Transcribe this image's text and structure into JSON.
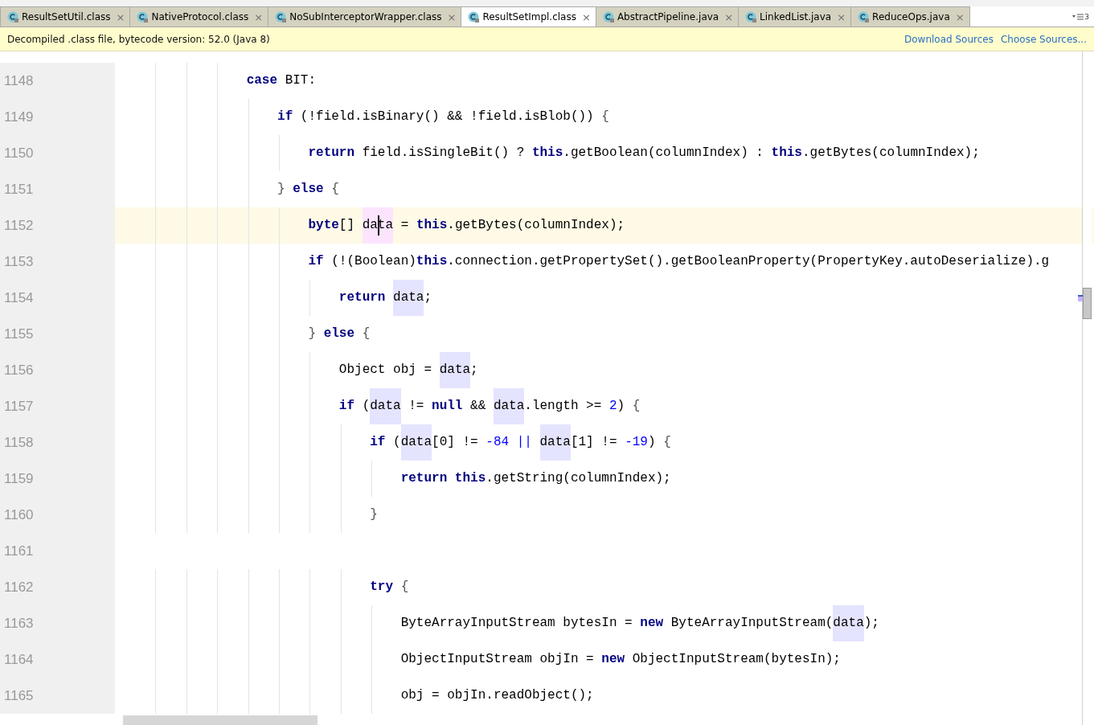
{
  "tabs": [
    {
      "label": "ResultSetUtil.class",
      "selected": false,
      "close": "×"
    },
    {
      "label": "NativeProtocol.class",
      "selected": false,
      "close": "×"
    },
    {
      "label": "NoSubInterceptorWrapper.class",
      "selected": false,
      "close": "×"
    },
    {
      "label": "ResultSetImpl.class",
      "selected": true,
      "close": "×"
    },
    {
      "label": "AbstractPipeline.java",
      "selected": false,
      "close": "×"
    },
    {
      "label": "LinkedList.java",
      "selected": false,
      "close": "×"
    },
    {
      "label": "ReduceOps.java",
      "selected": false,
      "close": "×"
    }
  ],
  "tab_overflow": {
    "count": "3"
  },
  "banner": {
    "message": "Decompiled .class file, bytecode version: 52.0 (Java 8)",
    "links": [
      "Download Sources",
      "Choose Sources..."
    ]
  },
  "lines": [
    {
      "number": "1148",
      "current": false,
      "tokens": [
        {
          "kind": "kw",
          "text": "                case"
        },
        {
          "kind": "plain",
          "text": " BIT:"
        }
      ]
    },
    {
      "number": "1149",
      "current": false,
      "tokens": [
        {
          "kind": "kw",
          "text": "                    if"
        },
        {
          "kind": "plain",
          "text": " (!field.isBinary() && !field.isBlob()) "
        },
        {
          "kind": "brace",
          "text": "{"
        }
      ]
    },
    {
      "number": "1150",
      "current": false,
      "tokens": [
        {
          "kind": "kw",
          "text": "                        return"
        },
        {
          "kind": "plain",
          "text": " field.isSingleBit() ? "
        },
        {
          "kind": "kw",
          "text": "this"
        },
        {
          "kind": "plain",
          "text": ".getBoolean(columnIndex) : "
        },
        {
          "kind": "kw",
          "text": "this"
        },
        {
          "kind": "plain",
          "text": ".getBytes(columnIndex);"
        }
      ]
    },
    {
      "number": "1151",
      "current": false,
      "tokens": [
        {
          "kind": "brace",
          "text": "                    }"
        },
        {
          "kind": "kw",
          "text": " else"
        },
        {
          "kind": "brace",
          "text": " {"
        }
      ]
    },
    {
      "number": "1152",
      "current": true,
      "tokens": [
        {
          "kind": "kw",
          "text": "                        byte"
        },
        {
          "kind": "plain",
          "text": "[] "
        },
        {
          "kind": "write",
          "text": "data",
          "caret": true
        },
        {
          "kind": "plain",
          "text": " = "
        },
        {
          "kind": "kw",
          "text": "this"
        },
        {
          "kind": "plain",
          "text": ".getBytes(columnIndex);"
        }
      ]
    },
    {
      "number": "1153",
      "current": false,
      "tokens": [
        {
          "kind": "kw",
          "text": "                        if"
        },
        {
          "kind": "plain",
          "text": " (!(Boolean)"
        },
        {
          "kind": "kw",
          "text": "this"
        },
        {
          "kind": "plain",
          "text": ".connection.getPropertySet().getBooleanProperty(PropertyKey.autoDeserialize).g"
        }
      ]
    },
    {
      "number": "1154",
      "current": false,
      "tokens": [
        {
          "kind": "kw",
          "text": "                            return "
        },
        {
          "kind": "ref",
          "text": "data"
        },
        {
          "kind": "plain",
          "text": ";"
        }
      ]
    },
    {
      "number": "1155",
      "current": false,
      "tokens": [
        {
          "kind": "brace",
          "text": "                        }"
        },
        {
          "kind": "kw",
          "text": " else"
        },
        {
          "kind": "brace",
          "text": " {"
        }
      ]
    },
    {
      "number": "1156",
      "current": false,
      "tokens": [
        {
          "kind": "plain",
          "text": "                            Object obj = "
        },
        {
          "kind": "ref",
          "text": "data"
        },
        {
          "kind": "plain",
          "text": ";"
        }
      ]
    },
    {
      "number": "1157",
      "current": false,
      "tokens": [
        {
          "kind": "kw",
          "text": "                            if"
        },
        {
          "kind": "plain",
          "text": " ("
        },
        {
          "kind": "ref",
          "text": "data"
        },
        {
          "kind": "plain",
          "text": " != "
        },
        {
          "kind": "kw",
          "text": "null"
        },
        {
          "kind": "plain",
          "text": " && "
        },
        {
          "kind": "ref",
          "text": "data"
        },
        {
          "kind": "plain",
          "text": ".length >= "
        },
        {
          "kind": "num",
          "text": "2"
        },
        {
          "kind": "plain",
          "text": ") "
        },
        {
          "kind": "brace",
          "text": "{"
        }
      ]
    },
    {
      "number": "1158",
      "current": false,
      "tokens": [
        {
          "kind": "kw",
          "text": "                                if"
        },
        {
          "kind": "plain",
          "text": " ("
        },
        {
          "kind": "ref",
          "text": "data"
        },
        {
          "kind": "plain",
          "text": "[0] != "
        },
        {
          "kind": "num",
          "text": "-84 || "
        },
        {
          "kind": "ref",
          "text": "data"
        },
        {
          "kind": "plain",
          "text": "[1] != "
        },
        {
          "kind": "num",
          "text": "-19"
        },
        {
          "kind": "plain",
          "text": ") "
        },
        {
          "kind": "brace",
          "text": "{"
        }
      ]
    },
    {
      "number": "1159",
      "current": false,
      "tokens": [
        {
          "kind": "kw",
          "text": "                                    return this"
        },
        {
          "kind": "plain",
          "text": ".getString(columnIndex);"
        }
      ]
    },
    {
      "number": "1160",
      "current": false,
      "tokens": [
        {
          "kind": "brace",
          "text": "                                }"
        }
      ]
    },
    {
      "number": "1161",
      "current": false
    },
    {
      "number": "1162",
      "current": false,
      "tokens": [
        {
          "kind": "kw",
          "text": "                                try"
        },
        {
          "kind": "brace",
          "text": " {"
        }
      ]
    },
    {
      "number": "1163",
      "current": false,
      "tokens": [
        {
          "kind": "plain",
          "text": "                                    ByteArrayInputStream bytesIn = "
        },
        {
          "kind": "kw",
          "text": "new"
        },
        {
          "kind": "plain",
          "text": " ByteArrayInputStream("
        },
        {
          "kind": "ref",
          "text": "data"
        },
        {
          "kind": "plain",
          "text": ");"
        }
      ]
    },
    {
      "number": "1164",
      "current": false,
      "tokens": [
        {
          "kind": "plain",
          "text": "                                    ObjectInputStream objIn = "
        },
        {
          "kind": "kw",
          "text": "new"
        },
        {
          "kind": "plain",
          "text": " ObjectInputStream(bytesIn);"
        }
      ]
    },
    {
      "number": "1165",
      "current": false,
      "tokens": [
        {
          "kind": "plain",
          "text": "                                    obj = objIn.readObject();"
        }
      ]
    }
  ]
}
